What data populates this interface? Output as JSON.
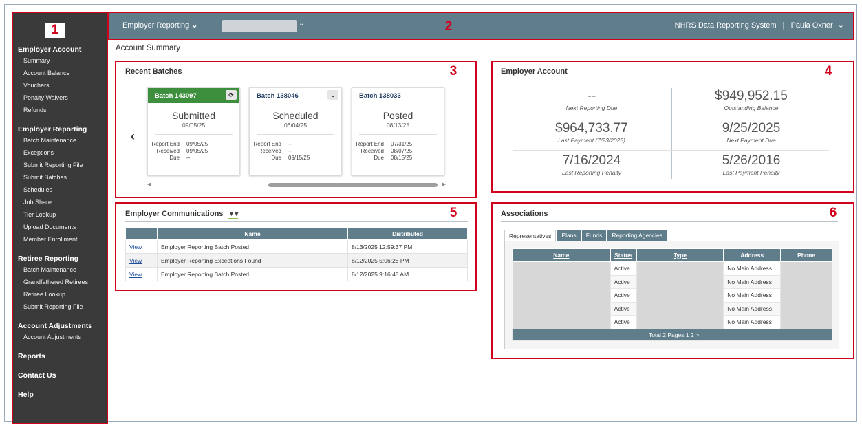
{
  "callouts": [
    "1",
    "2",
    "3",
    "4",
    "5",
    "6"
  ],
  "sidebar": {
    "sections": [
      {
        "label": "Employer Account",
        "items": [
          "Summary",
          "Account Balance",
          "Vouchers",
          "Penalty Waivers",
          "Refunds"
        ]
      },
      {
        "label": "Employer Reporting",
        "items": [
          "Batch Maintenance",
          "Exceptions",
          "Submit Reporting File",
          "Submit Batches",
          "Schedules",
          "Job Share",
          "Tier Lookup",
          "Upload Documents",
          "Member Enrollment"
        ]
      },
      {
        "label": "Retiree Reporting",
        "items": [
          "Batch Maintenance",
          "Grandfathered Retirees",
          "Retiree Lookup",
          "Submit Reporting File"
        ]
      },
      {
        "label": "Account Adjustments",
        "items": [
          "Account Adjustments"
        ]
      },
      {
        "label": "Reports",
        "items": []
      },
      {
        "label": "Contact Us",
        "items": []
      },
      {
        "label": "Help",
        "items": []
      }
    ]
  },
  "topbar": {
    "menu_label": "Employer Reporting",
    "menu_caret": "⌄",
    "select_caret": "⌄",
    "system_name": "NHRS Data Reporting System",
    "separator": "|",
    "user_name": "Paula Oxner",
    "user_caret": "⌄"
  },
  "breadcrumb": "Account Summary",
  "recent_batches": {
    "title": "Recent Batches",
    "prev_arrow": "‹",
    "cards": [
      {
        "name": "Batch 143097",
        "icon": "refresh-icon",
        "icon_glyph": "⟳",
        "state": "Submitted",
        "date": "09/05/25",
        "report_end": "09/05/25",
        "received": "09/05/25",
        "due": "--"
      },
      {
        "name": "Batch 138046",
        "icon": "chevron-down-icon",
        "icon_glyph": "⌄",
        "state": "Scheduled",
        "date": "06/04/25",
        "report_end": "--",
        "received": "--",
        "due": "09/15/25"
      },
      {
        "name": "Batch 138033",
        "icon": "",
        "icon_glyph": "",
        "state": "Posted",
        "date": "08/13/25",
        "report_end": "07/31/25",
        "received": "08/07/25",
        "due": "08/15/25"
      }
    ],
    "row_labels": {
      "report_end": "Report End",
      "received": "Received",
      "due": "Due"
    }
  },
  "employer_account": {
    "title": "Employer Account",
    "cells": [
      {
        "value": "--",
        "label": "Next Reporting Due"
      },
      {
        "value": "$949,952.15",
        "label": "Outstanding Balance"
      },
      {
        "value": "$964,733.77",
        "label": "Last Payment (7/23/2025)"
      },
      {
        "value": "9/25/2025",
        "label": "Next Payment Due"
      },
      {
        "value": "7/16/2024",
        "label": "Last Reporting Penalty"
      },
      {
        "value": "5/26/2016",
        "label": "Last Payment Penalty"
      }
    ]
  },
  "communications": {
    "title": "Employer Communications",
    "filter_icon": "filter-icon",
    "columns": [
      "",
      "Name",
      "Distributed"
    ],
    "rows": [
      {
        "action": "View",
        "name": "Employer Reporting Batch Posted",
        "distributed": "8/13/2025 12:59:37 PM"
      },
      {
        "action": "View",
        "name": "Employer Reporting Exceptions Found",
        "distributed": "8/12/2025 5:06:28 PM"
      },
      {
        "action": "View",
        "name": "Employer Reporting Batch Posted",
        "distributed": "8/12/2025 9:16:45 AM"
      }
    ]
  },
  "associations": {
    "title": "Associations",
    "tabs": [
      "Representatives",
      "Plans",
      "Funds",
      "Reporting Agencies"
    ],
    "columns": [
      "Name",
      "Status",
      "Type",
      "Address",
      "Phone"
    ],
    "rows": [
      {
        "status": "Active",
        "address": "No Main Address"
      },
      {
        "status": "Active",
        "address": "No Main Address"
      },
      {
        "status": "Active",
        "address": "No Main Address"
      },
      {
        "status": "Active",
        "address": "No Main Address"
      },
      {
        "status": "Active",
        "address": "No Main Address"
      }
    ],
    "footer": {
      "text": "Total 2 Pages",
      "current_page": "1",
      "next_page": "2",
      "next_link": ">"
    }
  },
  "colors": {
    "callout_red": "#d0021b",
    "header_slate": "#607d8b",
    "sidebar_dark": "#3a3a3a",
    "active_green": "#3d8f3d"
  }
}
